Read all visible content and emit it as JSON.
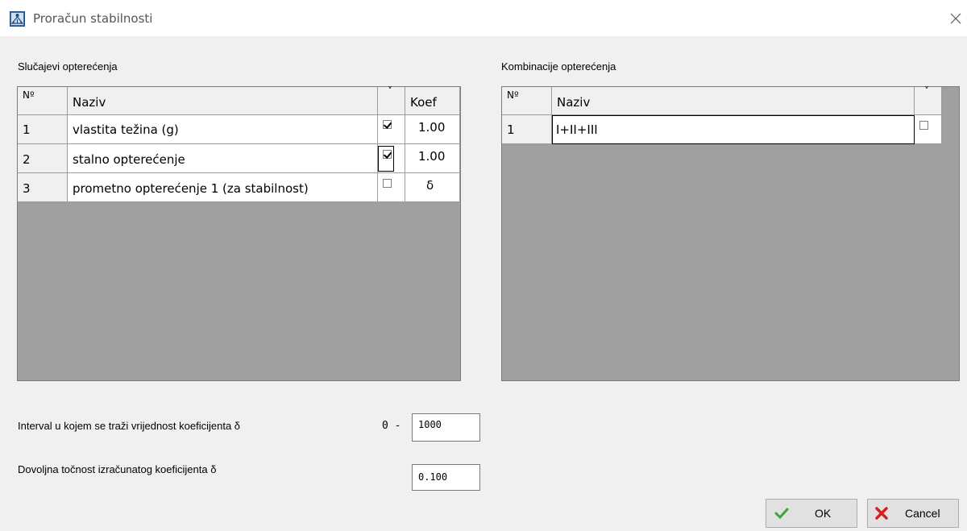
{
  "window": {
    "title": "Proračun stabilnosti",
    "icon": "structure-app-icon",
    "close": "close-icon"
  },
  "load_cases": {
    "label": "Slučajevi opterećenja",
    "headers": {
      "no": "Nº",
      "name": "Naziv",
      "check": "˅",
      "coef": "Koef"
    },
    "rows": [
      {
        "no": "1",
        "name": "vlastita težina (g)",
        "checked": true,
        "coef": "1.00"
      },
      {
        "no": "2",
        "name": "stalno opterećenje",
        "checked": true,
        "coef": "1.00"
      },
      {
        "no": "3",
        "name": "prometno opterećenje 1 (za stabilnost)",
        "checked": false,
        "coef": "δ"
      }
    ]
  },
  "load_combinations": {
    "label": "Kombinacije opterećenja",
    "headers": {
      "no": "Nº",
      "name": "Naziv",
      "check": "˅"
    },
    "rows": [
      {
        "no": "1",
        "name": "I+II+III",
        "checked": false
      }
    ]
  },
  "settings": {
    "interval_label": "Interval u kojem se traži vrijednost koeficijenta δ",
    "interval_prefix": "0 -",
    "interval_value": "1000",
    "accuracy_label": "Dovoljna točnost izračunatog koeficijenta δ",
    "accuracy_value": "0.100"
  },
  "buttons": {
    "ok": "OK",
    "cancel": "Cancel",
    "ok_icon": "checkmark-icon",
    "cancel_icon": "red-x-icon"
  },
  "colors": {
    "grid_bg": "#a0a0a0",
    "ok_green": "#3aa63a",
    "cancel_red": "#d42020"
  }
}
